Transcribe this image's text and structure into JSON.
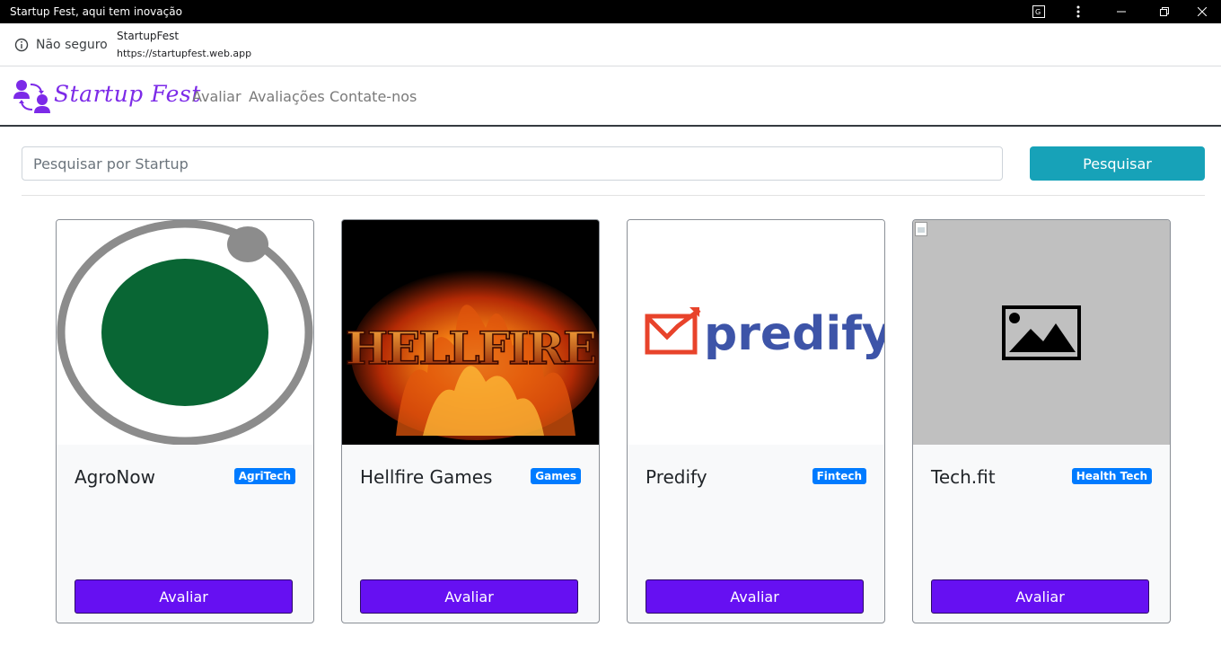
{
  "window": {
    "title": "Startup Fest, aqui tem inovação"
  },
  "addressbar": {
    "security_label": "Não seguro",
    "site_name": "StartupFest",
    "url": "https://startupfest.web.app"
  },
  "navbar": {
    "brand": "Startup Fest",
    "links": [
      "Avaliar",
      "Avaliações",
      "Contate-nos"
    ]
  },
  "search": {
    "placeholder": "Pesquisar por Startup",
    "value": "",
    "button_label": "Pesquisar"
  },
  "cards": [
    {
      "name": "AgroNow",
      "category": "AgriTech",
      "button_label": "Avaliar",
      "image": "agronow-logo"
    },
    {
      "name": "Hellfire Games",
      "category": "Games",
      "button_label": "Avaliar",
      "image": "hellfire-logo"
    },
    {
      "name": "Predify",
      "category": "Fintech",
      "button_label": "Avaliar",
      "image": "predify-logo",
      "logo_text": "predify"
    },
    {
      "name": "Tech.fit",
      "category": "Health Tech",
      "button_label": "Avaliar",
      "image": "image-placeholder-icon"
    }
  ],
  "colors": {
    "titlebar": "#000000",
    "brand": "#7c2ae8",
    "search_button": "#17a2b8",
    "eval_button": "#6610f2",
    "badge": "#007bff"
  }
}
